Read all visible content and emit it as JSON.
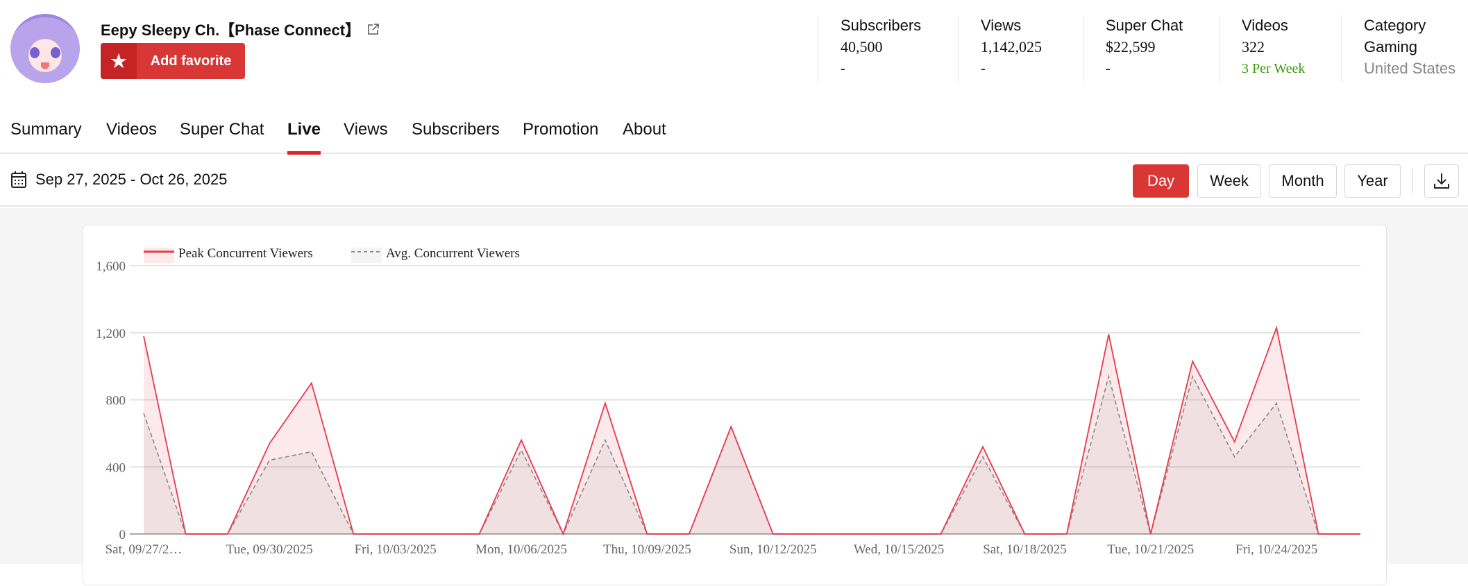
{
  "channel": {
    "name": "Eepy Sleepy Ch.【Phase Connect】",
    "favorite_label": "Add favorite"
  },
  "stats": [
    {
      "label": "Subscribers",
      "value": "40,500",
      "sub": "-"
    },
    {
      "label": "Views",
      "value": "1,142,025",
      "sub": "-"
    },
    {
      "label": "Super Chat",
      "value": "$22,599",
      "sub": "-"
    },
    {
      "label": "Videos",
      "value": "322",
      "sub": "3 Per Week"
    },
    {
      "label": "Category",
      "value": "Gaming",
      "sub": "United States"
    }
  ],
  "tabs": [
    "Summary",
    "Videos",
    "Super Chat",
    "Live",
    "Views",
    "Subscribers",
    "Promotion",
    "About"
  ],
  "active_tab": "Live",
  "date_range": "Sep 27, 2025 - Oct 26, 2025",
  "granularity": {
    "options": [
      "Day",
      "Week",
      "Month",
      "Year"
    ],
    "selected": "Day"
  },
  "colors": {
    "accent": "#d93636",
    "peak": "#e8394a",
    "avg": "#888888",
    "green": "#3a9a0a"
  },
  "chart_data": {
    "type": "area",
    "x": [
      "Sat, 09/27/2…",
      "09/28",
      "09/29",
      "Tue, 09/30/2025",
      "10/01",
      "10/02",
      "Fri, 10/03/2025",
      "10/04",
      "10/05",
      "Mon, 10/06/2025",
      "10/07",
      "10/08",
      "Thu, 10/09/2025",
      "10/10",
      "10/11",
      "Sun, 10/12/2025",
      "10/13",
      "10/14",
      "Wed, 10/15/2025",
      "10/16",
      "10/17",
      "Sat, 10/18/2025",
      "10/19",
      "10/20",
      "Tue, 10/21/2025",
      "10/22",
      "10/23",
      "Fri, 10/24/2025",
      "10/25",
      "10/26"
    ],
    "tick_labels": [
      "Sat, 09/27/2…",
      "Tue, 09/30/2025",
      "Fri, 10/03/2025",
      "Mon, 10/06/2025",
      "Thu, 10/09/2025",
      "Sun, 10/12/2025",
      "Wed, 10/15/2025",
      "Sat, 10/18/2025",
      "Tue, 10/21/2025",
      "Fri, 10/24/2025"
    ],
    "series": [
      {
        "name": "Peak Concurrent Viewers",
        "values": [
          1180,
          0,
          0,
          540,
          900,
          0,
          0,
          0,
          0,
          560,
          0,
          780,
          0,
          0,
          640,
          0,
          0,
          0,
          0,
          0,
          520,
          0,
          0,
          1190,
          0,
          1030,
          550,
          1230,
          0,
          0
        ]
      },
      {
        "name": "Avg. Concurrent Viewers",
        "values": [
          720,
          0,
          0,
          440,
          490,
          0,
          0,
          0,
          0,
          500,
          0,
          560,
          0,
          0,
          640,
          0,
          0,
          0,
          0,
          0,
          460,
          0,
          0,
          940,
          0,
          940,
          460,
          780,
          0,
          0
        ]
      }
    ],
    "yticks": [
      "0",
      "400",
      "800",
      "1,200",
      "1,600"
    ],
    "ylim": [
      0,
      1600
    ],
    "grid": true,
    "legend": "top-left"
  }
}
